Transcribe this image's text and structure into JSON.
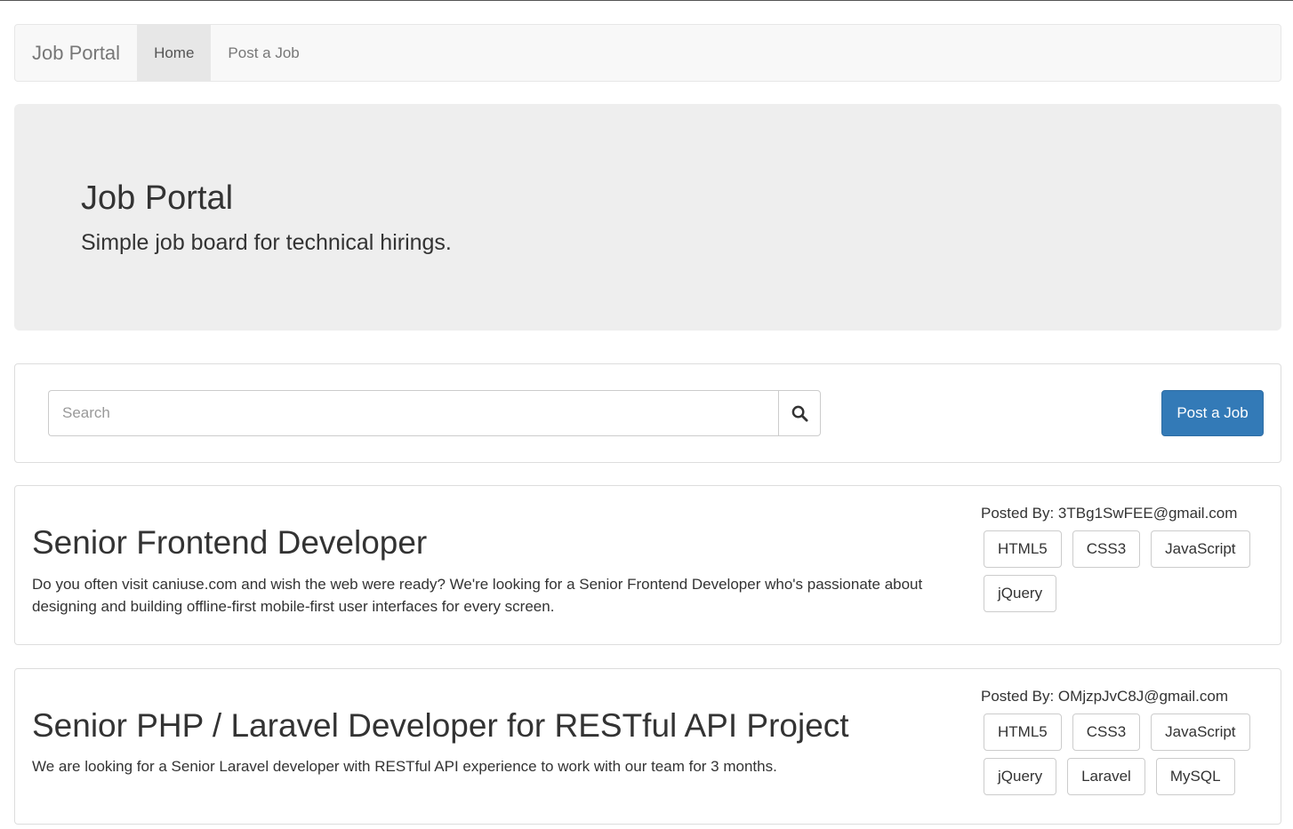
{
  "navbar": {
    "brand": "Job Portal",
    "items": [
      {
        "label": "Home",
        "active": true
      },
      {
        "label": "Post a Job",
        "active": false
      }
    ]
  },
  "hero": {
    "title": "Job Portal",
    "subtitle": "Simple job board for technical hirings."
  },
  "search": {
    "placeholder": "Search",
    "value": "",
    "button_icon": "search-icon",
    "post_button_label": "Post a Job"
  },
  "jobs": [
    {
      "title": "Senior Frontend Developer",
      "description": "Do you often visit caniuse.com and wish the web were ready? We're looking for a Senior Frontend Developer who's passionate about designing and building offline-first mobile-first user interfaces for every screen.",
      "posted_by": "Posted By: 3TBg1SwFEE@gmail.com",
      "tags": [
        "HTML5",
        "CSS3",
        "JavaScript",
        "jQuery"
      ]
    },
    {
      "title": "Senior PHP / Laravel Developer for RESTful API Project",
      "description": "We are looking for a Senior Laravel developer with RESTful API experience to work with our team for 3 months.",
      "posted_by": "Posted By: OMjzpJvC8J@gmail.com",
      "tags": [
        "HTML5",
        "CSS3",
        "JavaScript",
        "jQuery",
        "Laravel",
        "MySQL"
      ]
    }
  ],
  "colors": {
    "primary": "#337ab7",
    "navbar_bg": "#f8f8f8",
    "hero_bg": "#eeeeee"
  }
}
